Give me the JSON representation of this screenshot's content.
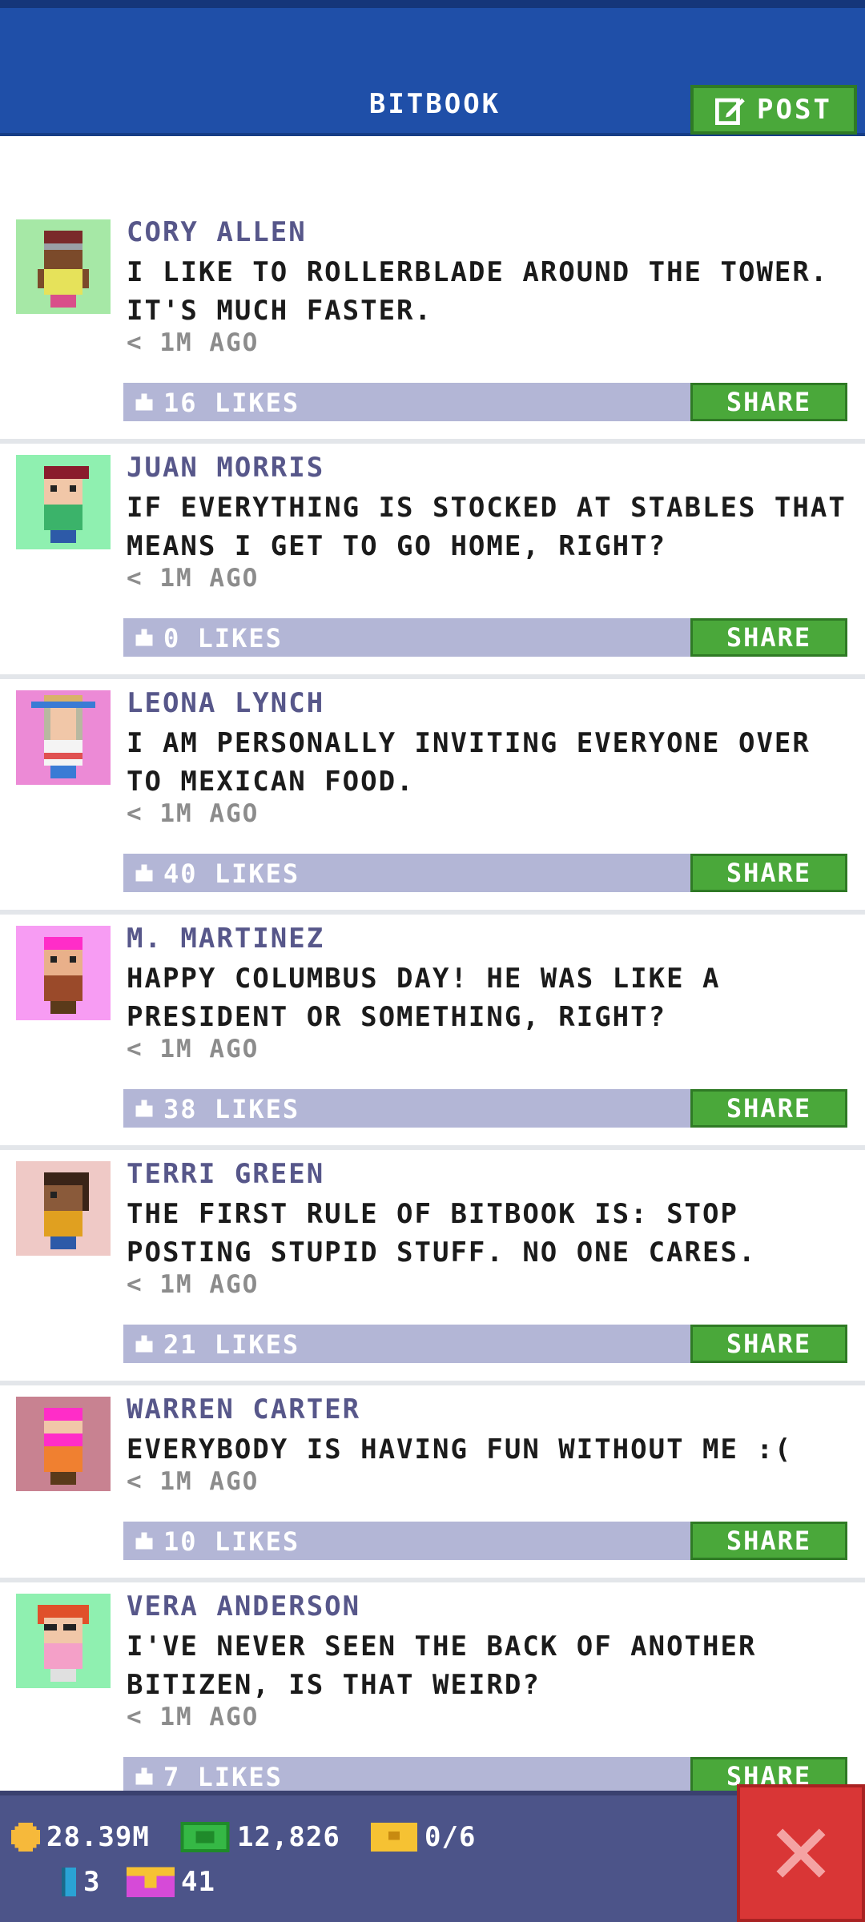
{
  "header": {
    "title": "BITBOOK",
    "post_label": "POST"
  },
  "posts": [
    {
      "author": "CORY ALLEN",
      "text": "I LIKE TO ROLLERBLADE AROUND THE TOWER. IT'S MUCH FASTER.",
      "time": "< 1M AGO",
      "likes": "16 LIKES",
      "share": "SHARE",
      "avatar_bg": "#a6e8a6"
    },
    {
      "author": "JUAN MORRIS",
      "text": "IF EVERYTHING IS STOCKED AT STABLES THAT MEANS I GET TO GO HOME, RIGHT?",
      "time": "< 1M AGO",
      "likes": "0 LIKES",
      "share": "SHARE",
      "avatar_bg": "#8ff0b0"
    },
    {
      "author": "LEONA LYNCH",
      "text": "I AM PERSONALLY INVITING EVERYONE OVER TO MEXICAN FOOD.",
      "time": "< 1M AGO",
      "likes": "40 LIKES",
      "share": "SHARE",
      "avatar_bg": "#ec8ad6"
    },
    {
      "author": "M. MARTINEZ",
      "text": "HAPPY COLUMBUS DAY! HE WAS LIKE A PRESIDENT OR SOMETHING, RIGHT?",
      "time": "< 1M AGO",
      "likes": "38 LIKES",
      "share": "SHARE",
      "avatar_bg": "#f79cf3"
    },
    {
      "author": "TERRI GREEN",
      "text": "THE FIRST RULE OF BITBOOK IS: STOP POSTING STUPID STUFF. NO ONE CARES.",
      "time": "< 1M AGO",
      "likes": "21 LIKES",
      "share": "SHARE",
      "avatar_bg": "#efc9c6"
    },
    {
      "author": "WARREN CARTER",
      "text": "EVERYBODY IS HAVING FUN WITHOUT ME :(",
      "time": "< 1M AGO",
      "likes": "10 LIKES",
      "share": "SHARE",
      "avatar_bg": "#c88291"
    },
    {
      "author": "VERA ANDERSON",
      "text": "I'VE NEVER SEEN THE BACK OF ANOTHER BITIZEN, IS THAT WEIRD?",
      "time": "< 1M AGO",
      "likes": "7 LIKES",
      "share": "SHARE",
      "avatar_bg": "#8ff0b0"
    }
  ],
  "status": {
    "coins": "28.39M",
    "bux": "12,826",
    "tickets": "0/6",
    "keys": "3",
    "gifts": "41"
  },
  "colors": {
    "header": "#1f4fa8",
    "share": "#4aa83a",
    "likes_bar": "#b3b6d6",
    "status_bar": "#4c5489",
    "close": "#d93636"
  }
}
